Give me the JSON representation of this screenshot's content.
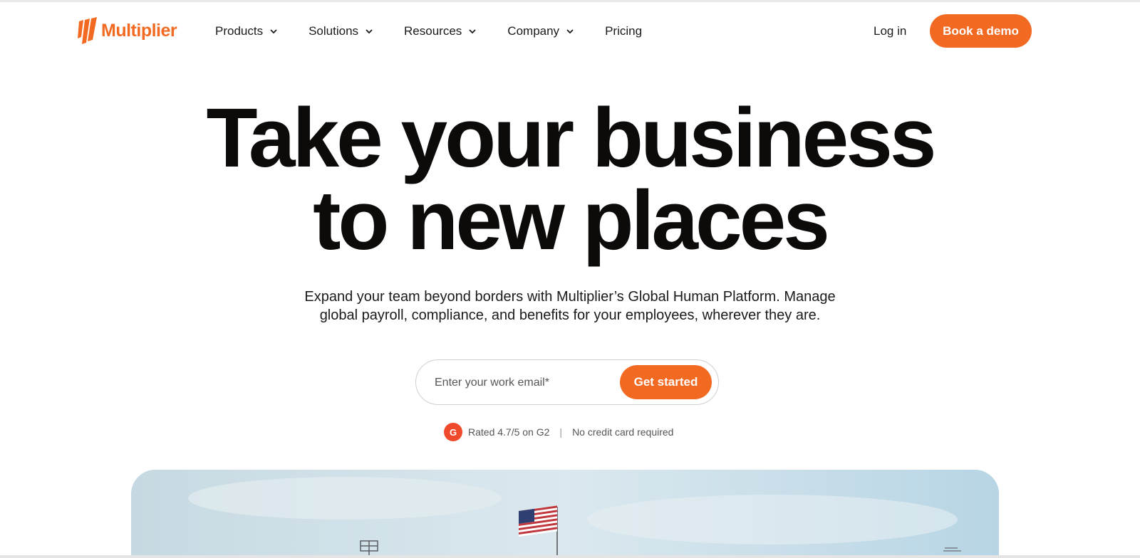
{
  "brand": {
    "name": "Multiplier",
    "accent": "#f26a21"
  },
  "nav": {
    "items": [
      {
        "label": "Products",
        "has_dropdown": true
      },
      {
        "label": "Solutions",
        "has_dropdown": true
      },
      {
        "label": "Resources",
        "has_dropdown": true
      },
      {
        "label": "Company",
        "has_dropdown": true
      },
      {
        "label": "Pricing",
        "has_dropdown": false
      }
    ],
    "login_label": "Log in",
    "demo_label": "Book a demo"
  },
  "hero": {
    "headline_line1": "Take your business",
    "headline_line2": "to new places",
    "subtitle_line1": "Expand your team beyond borders with Multiplier’s Global Human Platform. Manage",
    "subtitle_line2": "global payroll, compliance, and benefits for your employees, wherever they are.",
    "email_placeholder": "Enter your work email*",
    "cta_label": "Get started",
    "rating_badge": "G",
    "rating_text": "Rated 4.7/5 on G2",
    "separator": "|",
    "no_card_text": "No credit card required"
  },
  "image": {
    "icon": "flag-photo"
  }
}
